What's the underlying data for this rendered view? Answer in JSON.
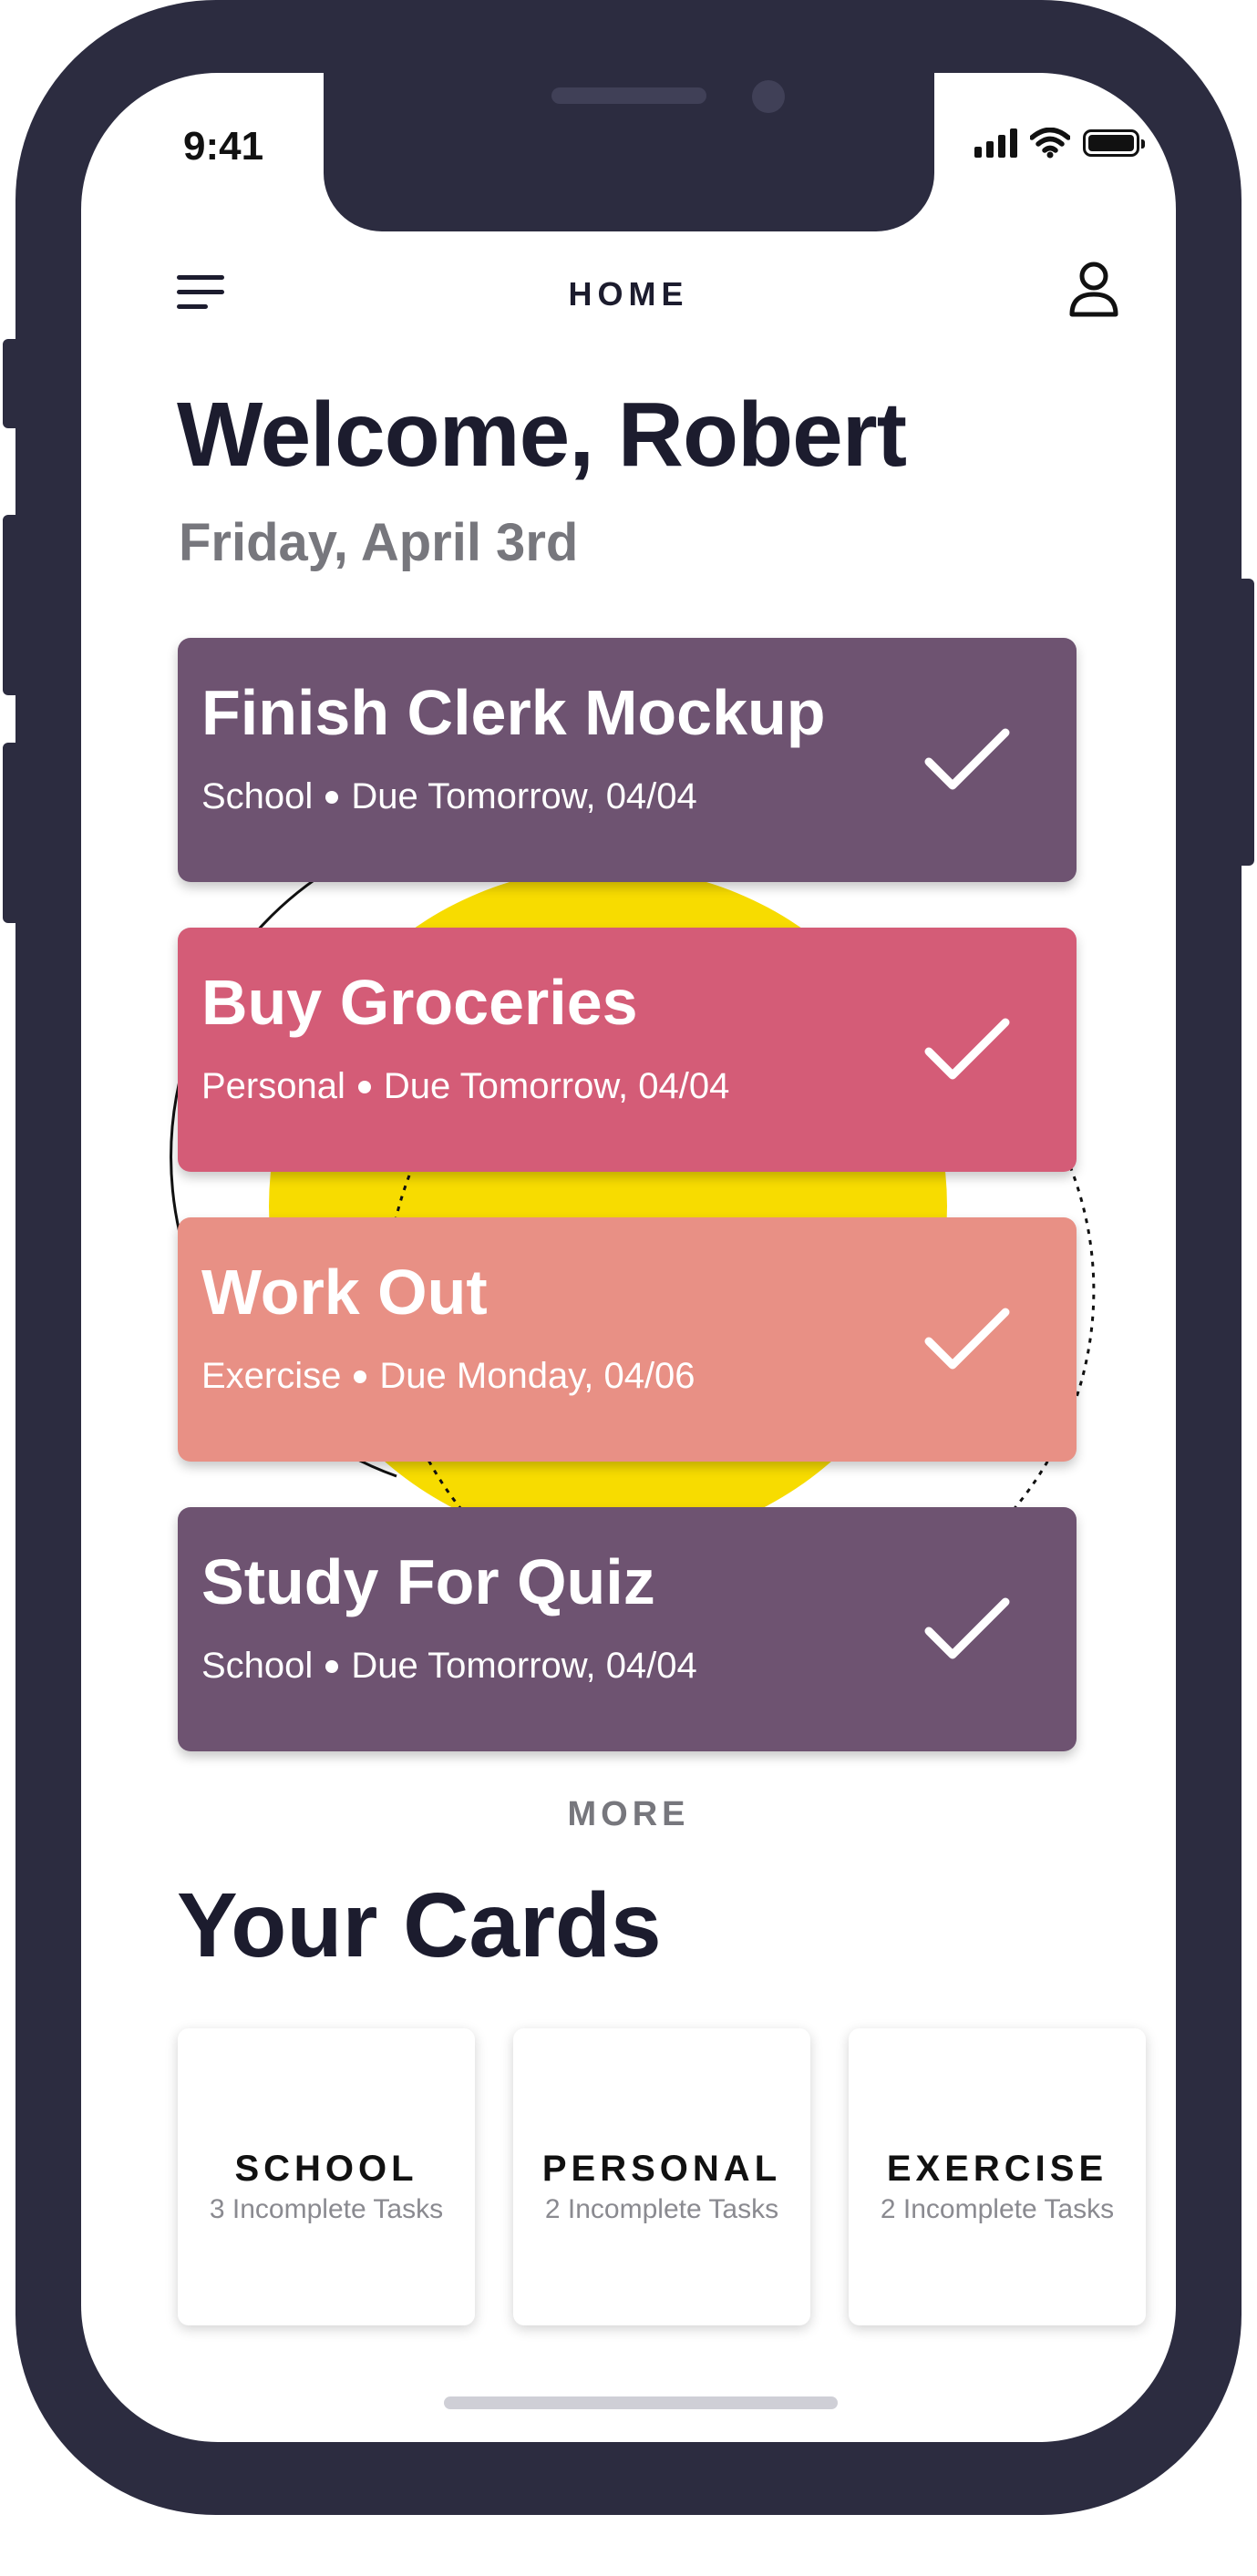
{
  "status_bar": {
    "time": "9:41"
  },
  "nav": {
    "title": "HOME"
  },
  "greeting": {
    "welcome": "Welcome, Robert",
    "date": "Friday, April 3rd"
  },
  "tasks": [
    {
      "title": "Finish Clerk Mockup",
      "category": "School",
      "due": "Due Tomorrow, 04/04",
      "color": "#6e5371"
    },
    {
      "title": "Buy Groceries",
      "category": "Personal",
      "due": "Due Tomorrow, 04/04",
      "color": "#d45c77"
    },
    {
      "title": "Work Out",
      "category": "Exercise",
      "due": "Due Monday, 04/06",
      "color": "#e89085"
    },
    {
      "title": "Study For Quiz",
      "category": "School",
      "due": "Due Tomorrow, 04/04",
      "color": "#6e5371"
    }
  ],
  "more_label": "MORE",
  "cards_section": {
    "title": "Your Cards",
    "cards": [
      {
        "label": "SCHOOL",
        "count": "3 Incomplete Tasks"
      },
      {
        "label": "PERSONAL",
        "count": "2 Incomplete Tasks"
      },
      {
        "label": "EXERCISE",
        "count": "2 Incomplete Tasks"
      }
    ]
  },
  "colors": {
    "frame": "#2c2c40",
    "heading": "#1c1c2e",
    "subtle": "#77777d",
    "accent_yellow": "#f7dc00"
  },
  "icons": [
    "menu-icon",
    "profile-icon",
    "check-icon",
    "signal-icon",
    "wifi-icon",
    "battery-icon"
  ]
}
